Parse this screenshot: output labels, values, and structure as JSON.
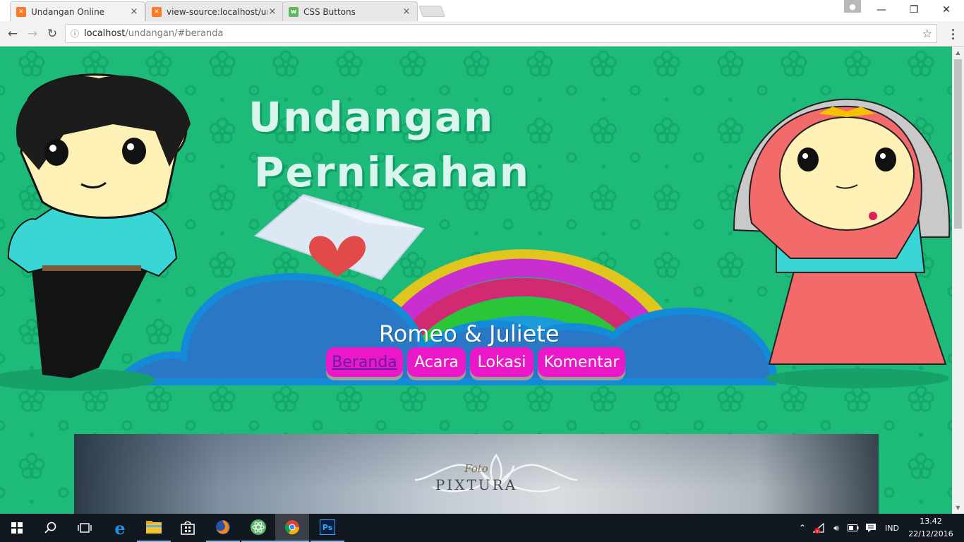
{
  "browser": {
    "tabs": [
      {
        "title": "Undangan Online",
        "active": true,
        "icon": "xampp-icon"
      },
      {
        "title": "view-source:localhost/ur",
        "active": false,
        "icon": "xampp-icon"
      },
      {
        "title": "CSS Buttons",
        "active": false,
        "icon": "w3schools-icon"
      }
    ],
    "url_host": "localhost",
    "url_path": "/undangan/#beranda"
  },
  "page": {
    "title_line1": "Undangan",
    "title_line2": "Pernikahan",
    "couple_name": "Romeo & Juliete",
    "nav": [
      {
        "label": "Beranda",
        "current": true
      },
      {
        "label": "Acara",
        "current": false
      },
      {
        "label": "Lokasi",
        "current": false
      },
      {
        "label": "Komentar",
        "current": false
      }
    ],
    "banner": {
      "brand": "PIXTURA",
      "script": "Foto"
    },
    "colors": {
      "background": "#1dba7a",
      "nav_button": "#ea18c8",
      "title": "#d9f5ee"
    }
  },
  "taskbar": {
    "apps": [
      "start-icon",
      "search-icon",
      "task-view-icon",
      "edge-icon",
      "file-explorer-icon",
      "store-icon",
      "firefox-icon",
      "atom-icon",
      "chrome-icon",
      "photoshop-icon"
    ],
    "language": "IND",
    "time": "13.42",
    "date": "22/12/2016"
  }
}
